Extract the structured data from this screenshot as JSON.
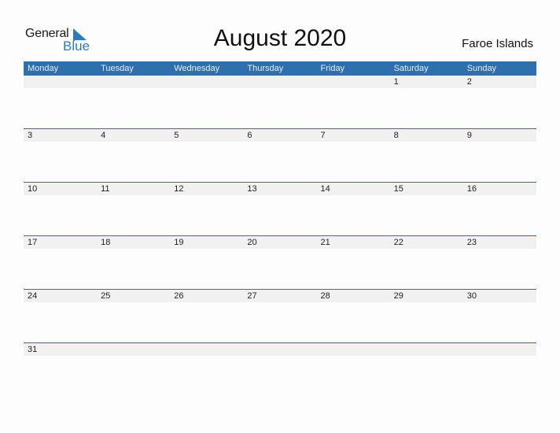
{
  "logo": {
    "general": "General",
    "blue": "Blue"
  },
  "title": "August 2020",
  "country": "Faroe Islands",
  "weekdays": [
    "Monday",
    "Tuesday",
    "Wednesday",
    "Thursday",
    "Friday",
    "Saturday",
    "Sunday"
  ],
  "weeks": [
    [
      "",
      "",
      "",
      "",
      "",
      "1",
      "2"
    ],
    [
      "3",
      "4",
      "5",
      "6",
      "7",
      "8",
      "9"
    ],
    [
      "10",
      "11",
      "12",
      "13",
      "14",
      "15",
      "16"
    ],
    [
      "17",
      "18",
      "19",
      "20",
      "21",
      "22",
      "23"
    ],
    [
      "24",
      "25",
      "26",
      "27",
      "28",
      "29",
      "30"
    ],
    [
      "31",
      "",
      "",
      "",
      "",
      "",
      ""
    ]
  ],
  "colors": {
    "header": "#2e6fad",
    "accent": "#2a7bc1",
    "strip": "#f1f1f1"
  }
}
